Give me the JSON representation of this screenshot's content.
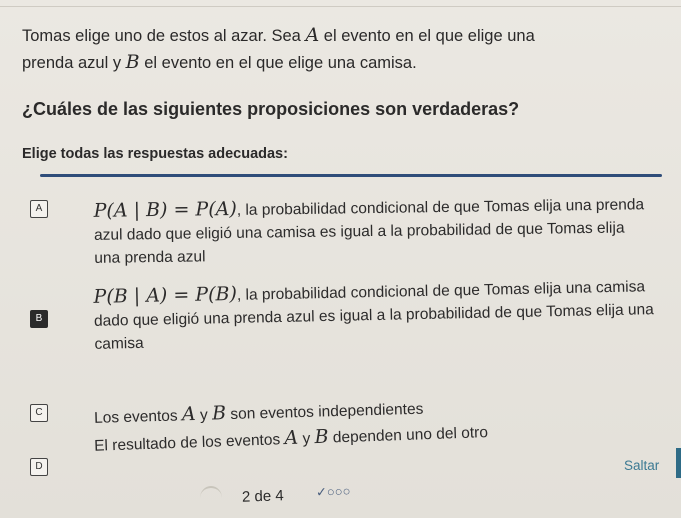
{
  "problem": {
    "prompt_line1": "Tomas elige uno de estos al azar. Sea",
    "event_a": "A",
    "prompt_line1b": "el evento en el que elige una",
    "prompt_line2": "prenda azul y",
    "event_b": "B",
    "prompt_line2b": "el evento en el que elige una camisa.",
    "question": "¿Cuáles de las siguientes proposiciones son verdaderas?",
    "instruction": "Elige todas las respuestas adecuadas:"
  },
  "options": [
    {
      "letter": "A",
      "math": "P(A | B) = P(A)",
      "text": ", la probabilidad condicional de que Tomas elija una prenda azul dado que eligió una camisa es igual a la probabilidad de que Tomas elija una prenda azul"
    },
    {
      "letter": "B",
      "math": "P(B | A) = P(B)",
      "text": ", la probabilidad condicional de que Tomas elija una camisa dado que eligió una prenda azul es igual a la probabilidad de que Tomas elija una camisa"
    },
    {
      "letter": "C",
      "text_pre": "Los eventos",
      "math1": "A",
      "mid": "y",
      "math2": "B",
      "text_post": "son eventos independientes"
    },
    {
      "letter": "D",
      "text_pre": "El resultado de los eventos",
      "math1": "A",
      "mid": "y",
      "math2": "B",
      "text_post": "dependen uno del otro"
    }
  ],
  "footer": {
    "progress": "2 de 4",
    "progress_dots": "✓○○○",
    "skip_label": "Saltar"
  },
  "colors": {
    "accent": "#2f4d7a",
    "link": "#3c7a93"
  }
}
